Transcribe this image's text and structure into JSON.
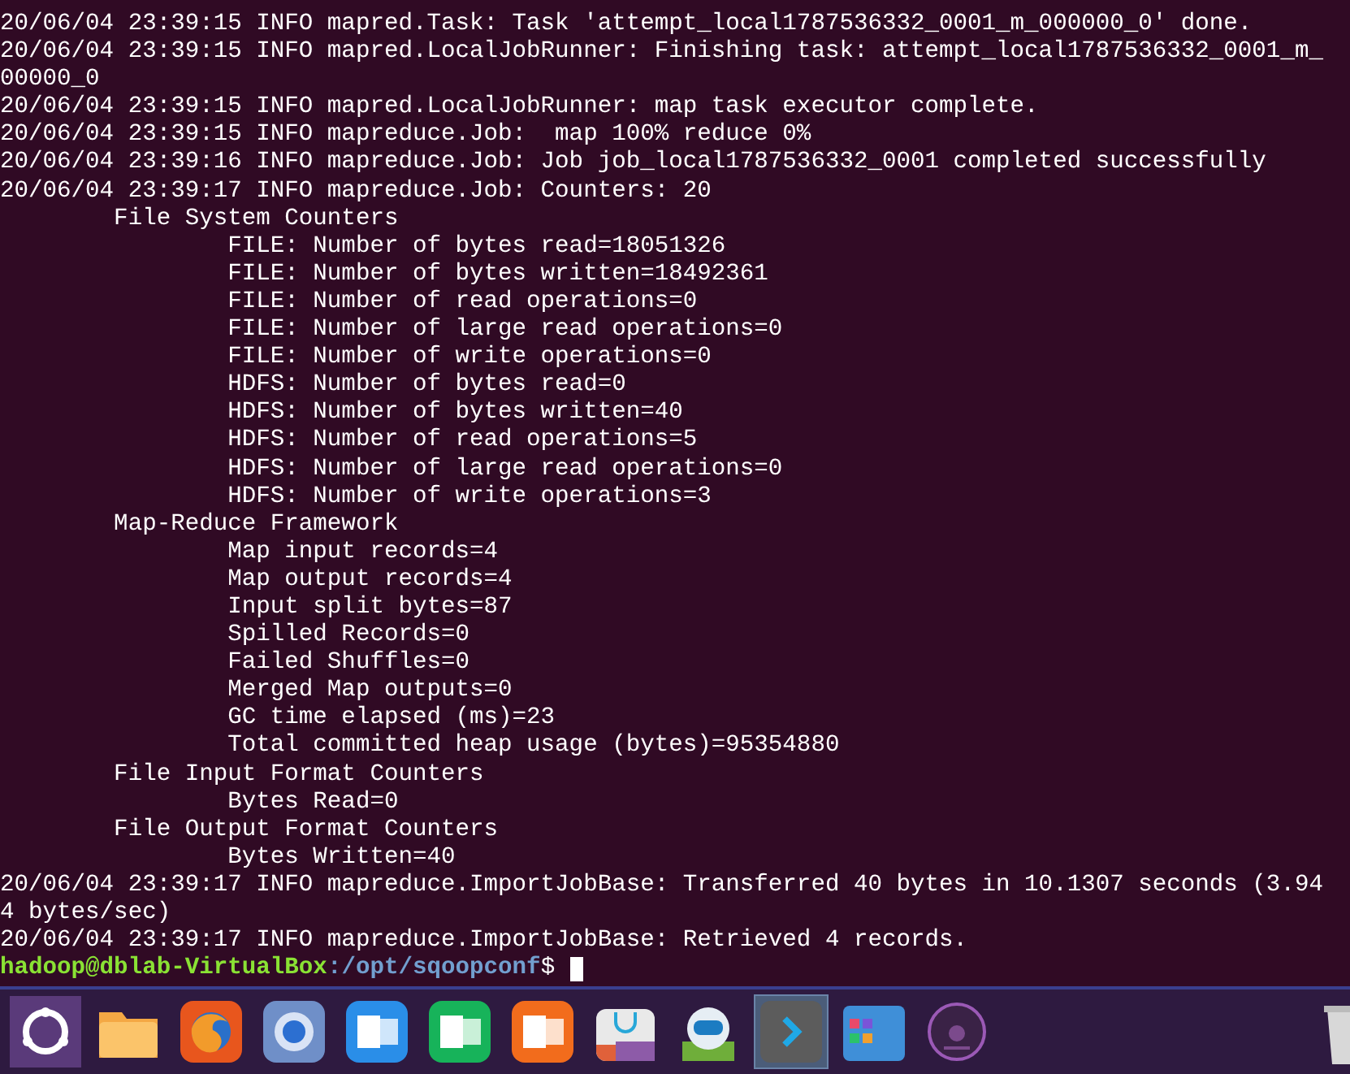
{
  "terminal": {
    "lines": [
      "20/06/04 23:39:15 INFO mapred.Task: Task 'attempt_local1787536332_0001_m_000000_0' done.",
      "20/06/04 23:39:15 INFO mapred.LocalJobRunner: Finishing task: attempt_local1787536332_0001_m_",
      "00000_0",
      "20/06/04 23:39:15 INFO mapred.LocalJobRunner: map task executor complete.",
      "20/06/04 23:39:15 INFO mapreduce.Job:  map 100% reduce 0%",
      "20/06/04 23:39:16 INFO mapreduce.Job: Job job_local1787536332_0001 completed successfully",
      "20/06/04 23:39:17 INFO mapreduce.Job: Counters: 20",
      "        File System Counters",
      "                FILE: Number of bytes read=18051326",
      "                FILE: Number of bytes written=18492361",
      "                FILE: Number of read operations=0",
      "                FILE: Number of large read operations=0",
      "                FILE: Number of write operations=0",
      "                HDFS: Number of bytes read=0",
      "                HDFS: Number of bytes written=40",
      "                HDFS: Number of read operations=5",
      "                HDFS: Number of large read operations=0",
      "                HDFS: Number of write operations=3",
      "        Map-Reduce Framework",
      "                Map input records=4",
      "                Map output records=4",
      "                Input split bytes=87",
      "                Spilled Records=0",
      "                Failed Shuffles=0",
      "                Merged Map outputs=0",
      "                GC time elapsed (ms)=23",
      "                Total committed heap usage (bytes)=95354880",
      "        File Input Format Counters",
      "                Bytes Read=0",
      "        File Output Format Counters",
      "                Bytes Written=40",
      "20/06/04 23:39:17 INFO mapreduce.ImportJobBase: Transferred 40 bytes in 10.1307 seconds (3.94",
      "4 bytes/sec)",
      "20/06/04 23:39:17 INFO mapreduce.ImportJobBase: Retrieved 4 records."
    ],
    "prompt": {
      "user_host": "hadoop@dblab-VirtualBox",
      "path": ":/opt/sqoopconf",
      "symbol": "$"
    }
  },
  "dock": [
    {
      "kind": "ubuntu",
      "selected": false
    },
    {
      "kind": "folder",
      "selected": false
    },
    {
      "kind": "firefox",
      "selected": false
    },
    {
      "kind": "browser",
      "selected": false
    },
    {
      "kind": "word",
      "selected": false
    },
    {
      "kind": "sheet",
      "selected": false
    },
    {
      "kind": "slides",
      "selected": false
    },
    {
      "kind": "store",
      "selected": false
    },
    {
      "kind": "robot",
      "selected": false
    },
    {
      "kind": "terminal",
      "selected": true
    },
    {
      "kind": "apps",
      "selected": false
    },
    {
      "kind": "disc",
      "selected": false
    }
  ]
}
